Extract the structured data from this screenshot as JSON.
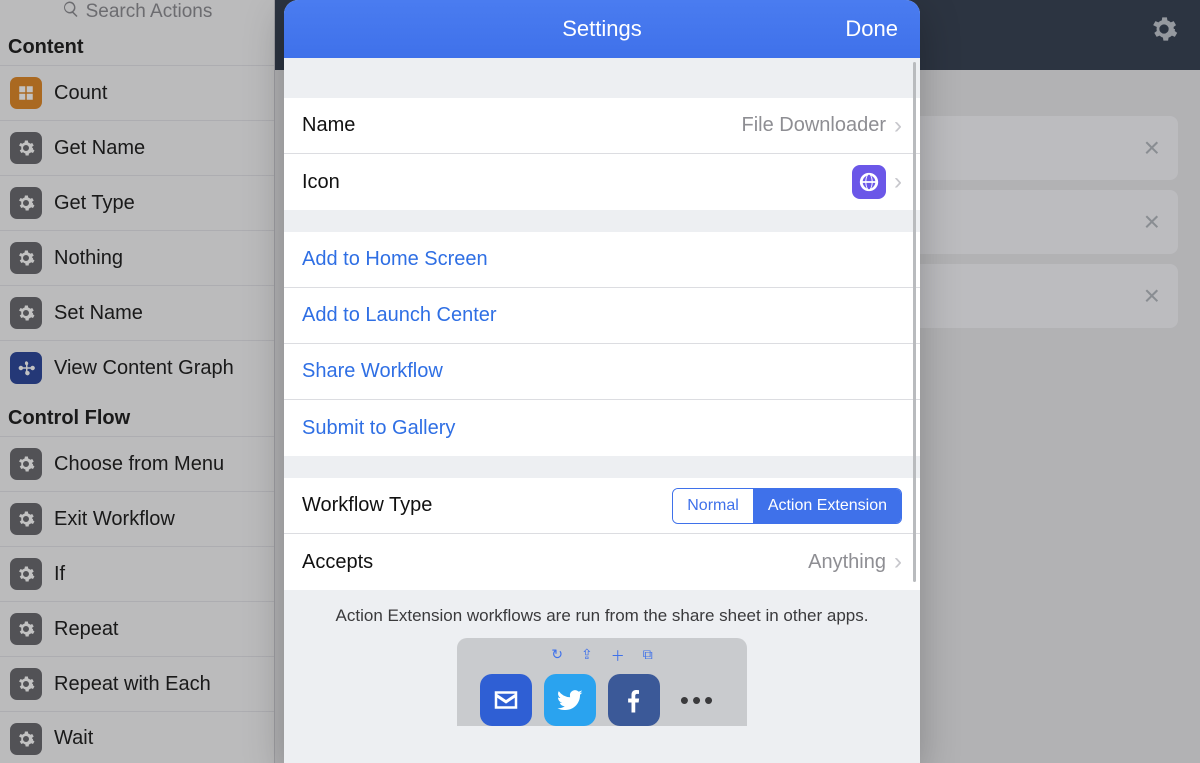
{
  "sidebar": {
    "search_placeholder": "Search Actions",
    "sections": [
      {
        "header": "Content",
        "items": [
          {
            "label": "Count",
            "icon": "count-icon",
            "icon_style": "ic-orange"
          },
          {
            "label": "Get Name",
            "icon": "gear-icon",
            "icon_style": "ic-gray"
          },
          {
            "label": "Get Type",
            "icon": "gear-icon",
            "icon_style": "ic-gray"
          },
          {
            "label": "Nothing",
            "icon": "gear-icon",
            "icon_style": "ic-gray"
          },
          {
            "label": "Set Name",
            "icon": "gear-icon",
            "icon_style": "ic-gray"
          },
          {
            "label": "View Content Graph",
            "icon": "graph-icon",
            "icon_style": "ic-blue"
          }
        ]
      },
      {
        "header": "Control Flow",
        "items": [
          {
            "label": "Choose from Menu",
            "icon": "gear-icon",
            "icon_style": "ic-gray"
          },
          {
            "label": "Exit Workflow",
            "icon": "gear-icon",
            "icon_style": "ic-gray"
          },
          {
            "label": "If",
            "icon": "gear-icon",
            "icon_style": "ic-gray"
          },
          {
            "label": "Repeat",
            "icon": "gear-icon",
            "icon_style": "ic-gray"
          },
          {
            "label": "Repeat with Each",
            "icon": "gear-icon",
            "icon_style": "ic-gray"
          },
          {
            "label": "Wait",
            "icon": "gear-icon",
            "icon_style": "ic-gray"
          }
        ]
      }
    ]
  },
  "sheet": {
    "title": "Settings",
    "done_label": "Done",
    "name_row_label": "Name",
    "name_value": "File Downloader",
    "icon_row_label": "Icon",
    "icon_name": "globe-icon",
    "action_links": [
      "Add to Home Screen",
      "Add to Launch Center",
      "Share Workflow",
      "Submit to Gallery"
    ],
    "workflow_type_label": "Workflow Type",
    "workflow_type_options": [
      "Normal",
      "Action Extension"
    ],
    "workflow_type_selected": "Action Extension",
    "accepts_label": "Accepts",
    "accepts_value": "Anything",
    "footer_note": "Action Extension workflows are run from the share sheet in other apps.",
    "mini_share_apps": [
      "mail",
      "twitter",
      "facebook",
      "more"
    ]
  },
  "colors": {
    "accent_blue": "#3f71ea",
    "link_blue": "#2f6fe4",
    "icon_purple": "#6b57e8"
  }
}
